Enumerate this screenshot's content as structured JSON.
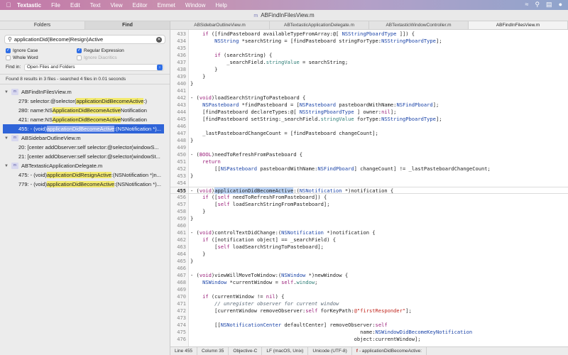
{
  "menubar": {
    "app": "Textastic",
    "items": [
      "File",
      "Edit",
      "Text",
      "View",
      "Editor",
      "Emmet",
      "Window",
      "Help"
    ],
    "right_icons": [
      "wifi-icon",
      "search-icon",
      "control-center-icon",
      "siri-icon"
    ]
  },
  "window": {
    "title": "ABFindInFilesView.m"
  },
  "sidebar": {
    "tabs": {
      "folders": "Folders",
      "find": "Find"
    },
    "search_value": "applicationDid(Become|Resign)Active",
    "options": {
      "ignore_case": "Ignore Case",
      "regex": "Regular Expression",
      "whole_word": "Whole Word",
      "ignore_diacritics": "Ignore Diacritics"
    },
    "find_in_label": "Find in:",
    "find_in_value": "Open Files and Folders",
    "summary": "Found 8 results in 3 files - searched 4 files in 0.01 seconds",
    "files": [
      {
        "name": "ABFindInFilesView.m",
        "hits": [
          {
            "pre": "279: selector:@selector(",
            "match": "applicationDidBecomeActive",
            "post": ":)"
          },
          {
            "pre": "280: name:NS",
            "match": "ApplicationDidBecomeActive",
            "post": "Notification"
          },
          {
            "pre": "421: name:NS",
            "match": "ApplicationDidBecomeActive",
            "post": "Notification"
          },
          {
            "pre": "455: - (void)",
            "match": "applicationDidBecomeActive",
            "post": ":(NSNotification *)..."
          }
        ]
      },
      {
        "name": "ABSidebarOutlineView.m",
        "hits": [
          {
            "pre": "20: [center addObserver:self selector:@selector(windowS...",
            "match": "",
            "post": ""
          },
          {
            "pre": "21: [center addObserver:self selector:@selector(windowSt...",
            "match": "",
            "post": ""
          }
        ]
      },
      {
        "name": "ABTextasticApplicationDelegate.m",
        "hits": [
          {
            "pre": "475: - (void)",
            "match": "applicationDidResignActive",
            "post": ":(NSNotification *)n..."
          },
          {
            "pre": "779: - (void)",
            "match": "applicationDidBecomeActive",
            "post": ":(NSNotification *)..."
          }
        ]
      }
    ]
  },
  "tabs": [
    "ABSidebarOutlineView.m",
    "ABTextasticApplicationDelegate.m",
    "ABTextasticWindowController.m",
    "ABFindInFilesView.m"
  ],
  "status": {
    "line": "Line 455",
    "column": "Column 35",
    "syntax": "Objective-C",
    "line_endings": "LF (macOS, Unix)",
    "encoding": "Unicode (UTF-8)",
    "symbol": "- applicationDidBecomeActive:"
  },
  "code": [
    {
      "n": "433",
      "t": "    if ([findPasteboard availableTypeFromArray:@[ NSStringPboardType ]]) {"
    },
    {
      "n": "434",
      "t": "        NSString *searchString = [findPasteboard stringForType:NSStringPboardType];"
    },
    {
      "n": "435",
      "t": ""
    },
    {
      "n": "436",
      "t": "        if (searchString) {"
    },
    {
      "n": "437",
      "t": "            _searchField.stringValue = searchString;"
    },
    {
      "n": "438",
      "t": "        }"
    },
    {
      "n": "439",
      "t": "    }"
    },
    {
      "n": "440",
      "t": "}"
    },
    {
      "n": "441",
      "t": ""
    },
    {
      "n": "442",
      "t": "- (void)loadSearchStringToPasteboard {"
    },
    {
      "n": "443",
      "t": "    NSPasteboard *findPasteboard = [NSPasteboard pasteboardWithName:NSFindPboard];"
    },
    {
      "n": "444",
      "t": "    [findPasteboard declareTypes:@[ NSStringPboardType ] owner:nil];"
    },
    {
      "n": "445",
      "t": "    [findPasteboard setString:_searchField.stringValue forType:NSStringPboardType];"
    },
    {
      "n": "446",
      "t": ""
    },
    {
      "n": "447",
      "t": "    _lastPasteboardChangeCount = [findPasteboard changeCount];"
    },
    {
      "n": "448",
      "t": "}"
    },
    {
      "n": "449",
      "t": ""
    },
    {
      "n": "450",
      "t": "- (BOOL)needToRefreshFromPasteboard {"
    },
    {
      "n": "451",
      "t": "    return"
    },
    {
      "n": "452",
      "t": "        [[NSPasteboard pasteboardWithName:NSFindPboard] changeCount] != _lastPasteboardChangeCount;"
    },
    {
      "n": "453",
      "t": "}"
    },
    {
      "n": "454",
      "t": ""
    },
    {
      "n": "455",
      "t": "- (void)applicationDidBecomeActive:(NSNotification *)notification {"
    },
    {
      "n": "456",
      "t": "    if ([self needToRefreshFromPasteboard]) {"
    },
    {
      "n": "457",
      "t": "        [self loadSearchStringFromPasteboard];"
    },
    {
      "n": "458",
      "t": "    }"
    },
    {
      "n": "459",
      "t": "}"
    },
    {
      "n": "460",
      "t": ""
    },
    {
      "n": "461",
      "t": "- (void)controlTextDidChange:(NSNotification *)notification {"
    },
    {
      "n": "462",
      "t": "    if ([notification object] == _searchField) {"
    },
    {
      "n": "463",
      "t": "        [self loadSearchStringToPasteboard];"
    },
    {
      "n": "464",
      "t": "    }"
    },
    {
      "n": "465",
      "t": "}"
    },
    {
      "n": "466",
      "t": ""
    },
    {
      "n": "467",
      "t": "- (void)viewWillMoveToWindow:(NSWindow *)newWindow {"
    },
    {
      "n": "468",
      "t": "    NSWindow *currentWindow = self.window;"
    },
    {
      "n": "469",
      "t": ""
    },
    {
      "n": "470",
      "t": "    if (currentWindow != nil) {"
    },
    {
      "n": "471",
      "t": "        // unregister observer for current window"
    },
    {
      "n": "472",
      "t": "        [currentWindow removeObserver:self forKeyPath:@\"firstResponder\"];"
    },
    {
      "n": "473",
      "t": ""
    },
    {
      "n": "474",
      "t": "        [[NSNotificationCenter defaultCenter] removeObserver:self"
    },
    {
      "n": "475",
      "t": "                                                        name:NSWindowDidBecomeKeyNotification"
    },
    {
      "n": "476",
      "t": "                                                      object:currentWindow];"
    }
  ],
  "current_line": "455",
  "highlight_token": "applicationDidBecomeActive"
}
